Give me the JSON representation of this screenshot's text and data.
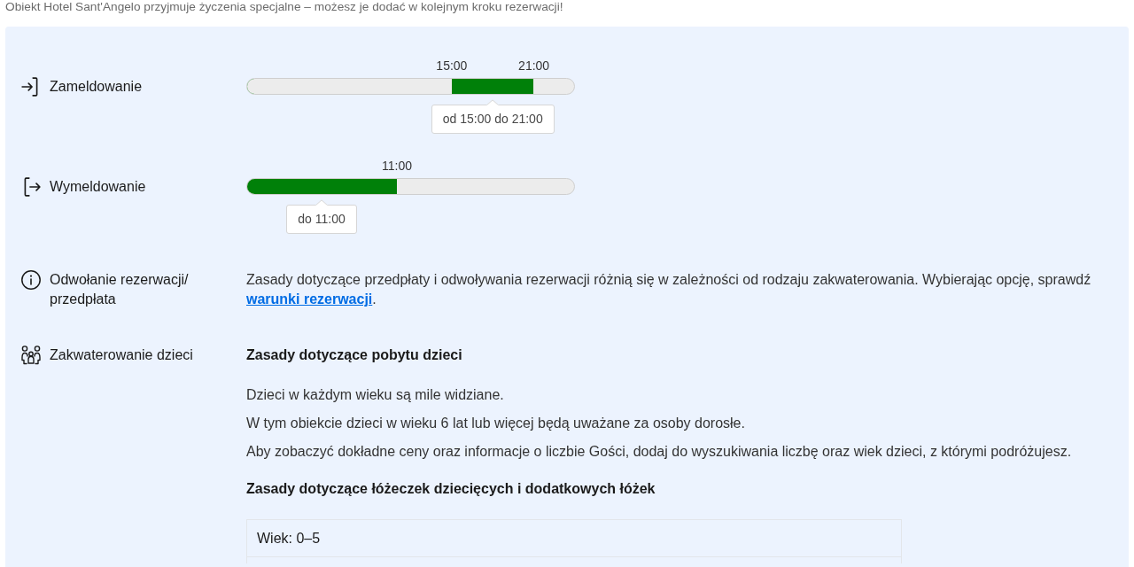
{
  "notice": "Obiekt Hotel Sant'Angelo przyjmuje życzenia specjalne – możesz je dodać w kolejnym kroku rezerwacji!",
  "rules": [
    {
      "kind": "check_in",
      "label": "Zameldowanie",
      "range": {
        "start": {
          "label": "15:00",
          "level": 0.625
        },
        "end": {
          "label": "21:00",
          "level": 0.875
        }
      },
      "tooltip": "od 15:00 do 21:00"
    },
    {
      "kind": "check_out",
      "label": "Wymeldowanie",
      "range": {
        "end": {
          "label": "11:00",
          "level": 0.4583
        }
      },
      "tooltip": "do 11:00"
    },
    {
      "kind": "cancellation",
      "label": "Odwołanie rezerwacji/ przedpłata",
      "text": "Zasady dotyczące przedpłaty i odwoływania rezerwacji różnią się w zależności od rodzaju zakwaterowania. Wybierając opcję, sprawdź",
      "link": "warunki rezerwacji",
      "text_after": "."
    },
    {
      "kind": "children",
      "label": "Zakwaterowanie dzieci",
      "blocks": [
        {
          "kind": "heading",
          "text": "Zasady dotyczące pobytu dzieci"
        },
        {
          "kind": "paragraph",
          "text": "Dzieci w każdym wieku są mile widziane."
        },
        {
          "kind": "paragraph",
          "text": "W tym obiekcie dzieci w wieku 6 lat lub więcej będą uważane za osoby dorosłe."
        },
        {
          "kind": "paragraph",
          "text": "Aby zobaczyć dokładne ceny oraz informacje o liczbie Gości, dodaj do wyszukiwania liczbę oraz wiek dzieci, z którymi podróżujesz."
        },
        {
          "kind": "heading",
          "text": "Zasady dotyczące łóżeczek dziecięcych i dodatkowych łóżek"
        },
        {
          "kind": "table",
          "header": "Wiek: 0–5"
        }
      ]
    }
  ]
}
